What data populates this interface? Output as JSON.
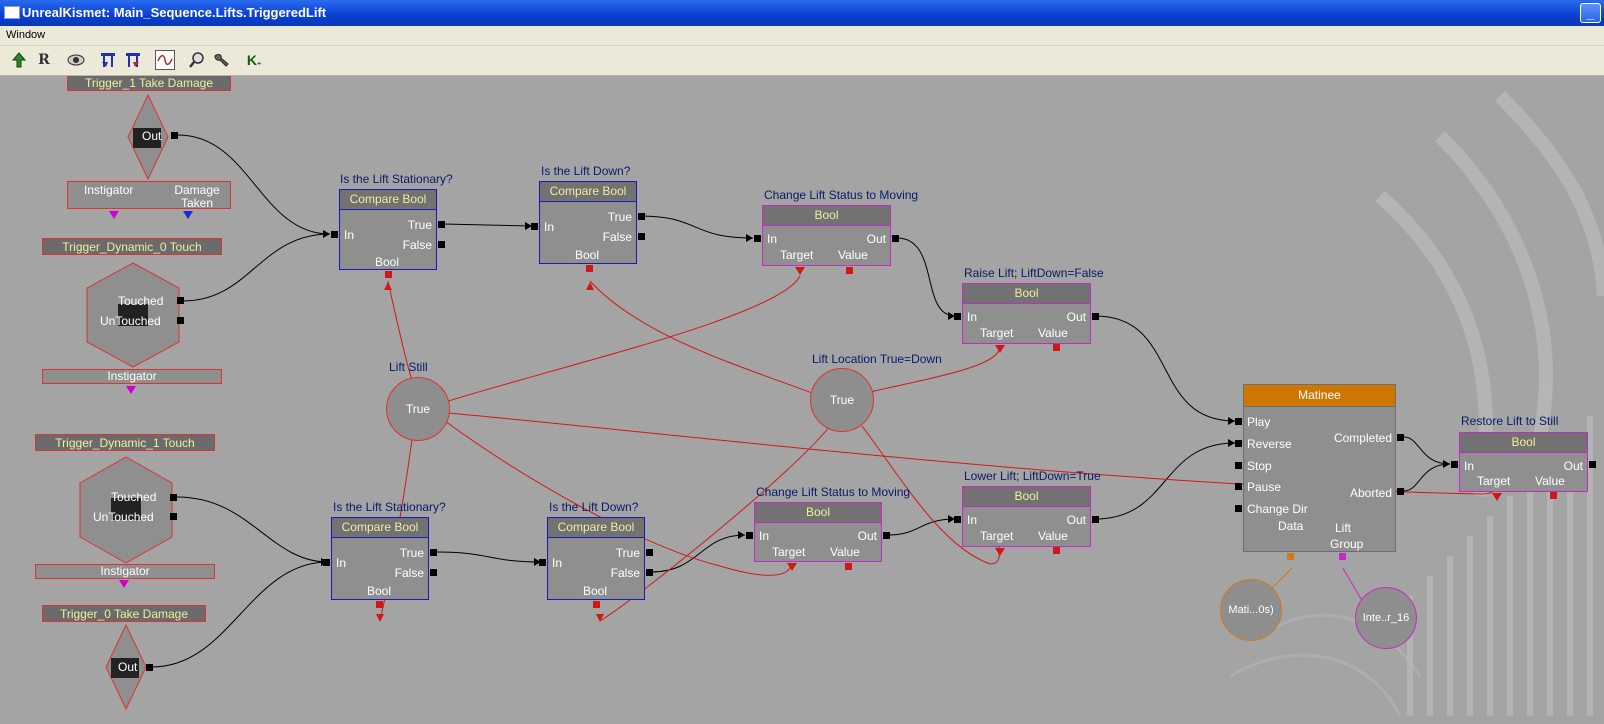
{
  "window": {
    "title": "UnrealKismet: Main_Sequence.Lifts.TriggeredLift"
  },
  "menu": {
    "items": [
      "Window"
    ]
  },
  "toolbar": {
    "buttons": [
      "up-arrow-icon",
      "r-icon",
      "eye-icon",
      "blue-tack-icon",
      "red-tack-icon",
      "graph-icon",
      "search-icon",
      "wrench-icon",
      "k-icon"
    ]
  },
  "events": {
    "trigger1_damage": {
      "label": "Trigger_1 Take Damage",
      "out": "Out",
      "vars": [
        "Instigator",
        "Damage Taken"
      ]
    },
    "dyn0_touch": {
      "label": "Trigger_Dynamic_0 Touch",
      "out1": "Touched",
      "out2": "UnTouched",
      "var": "Instigator"
    },
    "dyn1_touch": {
      "label": "Trigger_Dynamic_1 Touch",
      "out1": "Touched",
      "out2": "UnTouched",
      "var": "Instigator"
    },
    "trigger0_damage": {
      "label": "Trigger_0 Take Damage",
      "out": "Out"
    }
  },
  "nodes": {
    "cmp1": {
      "comment": "Is the Lift Stationary?",
      "title": "Compare Bool",
      "in": "In",
      "out1": "True",
      "out2": "False",
      "var": "Bool"
    },
    "cmp2": {
      "comment": "Is the Lift Down?",
      "title": "Compare Bool",
      "in": "In",
      "out1": "True",
      "out2": "False",
      "var": "Bool"
    },
    "cmp3": {
      "comment": "Is the Lift Stationary?",
      "title": "Compare Bool",
      "in": "In",
      "out1": "True",
      "out2": "False",
      "var": "Bool"
    },
    "cmp4": {
      "comment": "Is the Lift Down?",
      "title": "Compare Bool",
      "in": "In",
      "out1": "True",
      "out2": "False",
      "var": "Bool"
    },
    "bool1": {
      "comment": "Change Lift Status to Moving",
      "title": "Bool",
      "in": "In",
      "out": "Out",
      "target": "Target",
      "value": "Value"
    },
    "bool2": {
      "comment": "Raise Lift; LiftDown=False",
      "title": "Bool",
      "in": "In",
      "out": "Out",
      "target": "Target",
      "value": "Value"
    },
    "bool3": {
      "comment": "Change Lift Status to Moving",
      "title": "Bool",
      "in": "In",
      "out": "Out",
      "target": "Target",
      "value": "Value"
    },
    "bool4": {
      "comment": "Lower Lift; LiftDown=True",
      "title": "Bool",
      "in": "In",
      "out": "Out",
      "target": "Target",
      "value": "Value"
    },
    "bool5": {
      "comment": "Restore Lift to Still",
      "title": "Bool",
      "in": "In",
      "out": "Out",
      "target": "Target",
      "value": "Value"
    },
    "matinee": {
      "title": "Matinee",
      "inputs": [
        "Play",
        "Reverse",
        "Stop",
        "Pause",
        "Change Dir"
      ],
      "outputs": [
        "Completed",
        "Aborted"
      ],
      "var1": "Data",
      "var2a": "Lift",
      "var2b": "Group"
    }
  },
  "variables": {
    "lift_still": {
      "comment": "Lift Still",
      "value": "True"
    },
    "lift_location": {
      "comment": "Lift Location True=Down",
      "value": "True"
    },
    "matinee_data": {
      "value": "Mati...0s)"
    },
    "interp_group": {
      "value": "Inte..r_16"
    }
  }
}
